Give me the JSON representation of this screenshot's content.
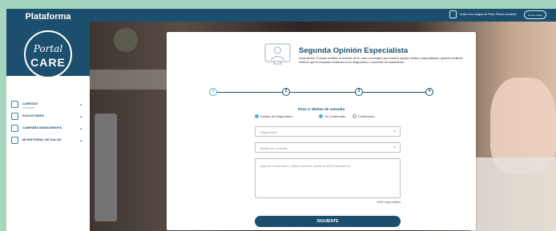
{
  "sidebar": {
    "brand_title": "Plataforma",
    "logo_portal": "Portal",
    "logo_care": "CARE",
    "items": [
      {
        "label": "CUENTAS",
        "sublabel": "Mi cuenta",
        "icon": "account-icon"
      },
      {
        "label": "SOLICITUDES",
        "sublabel": "",
        "icon": "requests-icon"
      },
      {
        "label": "CAMPAÑA MAMOGRAFIA",
        "sublabel": "",
        "icon": "campaign-icon"
      },
      {
        "label": "MI HISTORIAL DE SALUD",
        "sublabel": "",
        "icon": "health-history-icon"
      }
    ]
  },
  "topbar": {
    "user_text": "Invita a tus amigos de Pablo Pinerro Amabole",
    "logout_label": "Cerrar sesión"
  },
  "card": {
    "title": "Segunda Opinión Especialista",
    "description": "Descripción: Puedes solicitar la revisión de tu caso oncológico por nuestro equipo médico especializado, quienes emitirán informe que te brindará confianza en tu diagnóstico u opciones de tratamiento.",
    "steps": [
      "1",
      "2",
      "3",
      "4"
    ],
    "active_step": 1,
    "step_heading": "Paso 1: Motivo de consulta",
    "radios": [
      {
        "label": "Estado de Diagnóstico",
        "selected": true
      },
      {
        "label": "Ya Confirmado",
        "selected": true
      },
      {
        "label": "Confirmado",
        "selected": false
      }
    ],
    "select_diagnosis": "Diagnóstico",
    "select_reason": "Motivo de consulta",
    "textarea_placeholder": "Ingrese comentario u observaciones (máximo 1000 caracteres)",
    "counter": "1000 disponibles",
    "submit_label": "SIGUIENTE"
  },
  "colors": {
    "primary": "#1b4f6d",
    "accent": "#4bb8c8",
    "outer_bg": "#a6d6bf"
  }
}
